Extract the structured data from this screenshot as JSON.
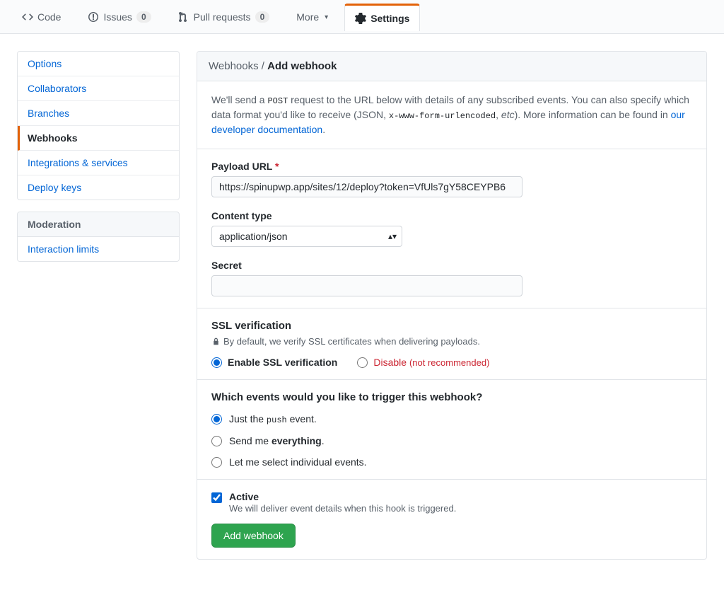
{
  "nav": {
    "code": "Code",
    "issues": "Issues",
    "issues_count": "0",
    "pulls": "Pull requests",
    "pulls_count": "0",
    "more": "More",
    "settings": "Settings"
  },
  "sidebar": {
    "items": [
      "Options",
      "Collaborators",
      "Branches",
      "Webhooks",
      "Integrations & services",
      "Deploy keys"
    ],
    "moderation_header": "Moderation",
    "moderation_items": [
      "Interaction limits"
    ]
  },
  "header": {
    "breadcrumb_parent": "Webhooks / ",
    "breadcrumb_current": "Add webhook"
  },
  "intro": {
    "pre": "We'll send a ",
    "post_code": "POST",
    "mid": " request to the URL below with details of any subscribed events. You can also specify which data format you'd like to receive (JSON, ",
    "enc_code": "x-www-form-urlencoded",
    "mid2": ", ",
    "etc": "etc",
    "mid3": "). More information can be found in ",
    "link": "our developer documentation",
    "tail": "."
  },
  "form": {
    "payload_label": "Payload URL",
    "payload_value": "https://spinupwp.app/sites/12/deploy?token=VfUls7gY58CEYPB6",
    "content_type_label": "Content type",
    "content_type_value": "application/json",
    "secret_label": "Secret",
    "secret_value": ""
  },
  "ssl": {
    "title": "SSL verification",
    "note": "By default, we verify SSL certificates when delivering payloads.",
    "enable": "Enable SSL verification",
    "disable": "Disable",
    "disable_note": "(not recommended)"
  },
  "events": {
    "title": "Which events would you like to trigger this webhook?",
    "push_pre": "Just the ",
    "push_code": "push",
    "push_post": " event.",
    "everything_pre": "Send me ",
    "everything_strong": "everything",
    "everything_post": ".",
    "individual": "Let me select individual events."
  },
  "active": {
    "label": "Active",
    "note": "We will deliver event details when this hook is triggered."
  },
  "submit": {
    "label": "Add webhook"
  }
}
